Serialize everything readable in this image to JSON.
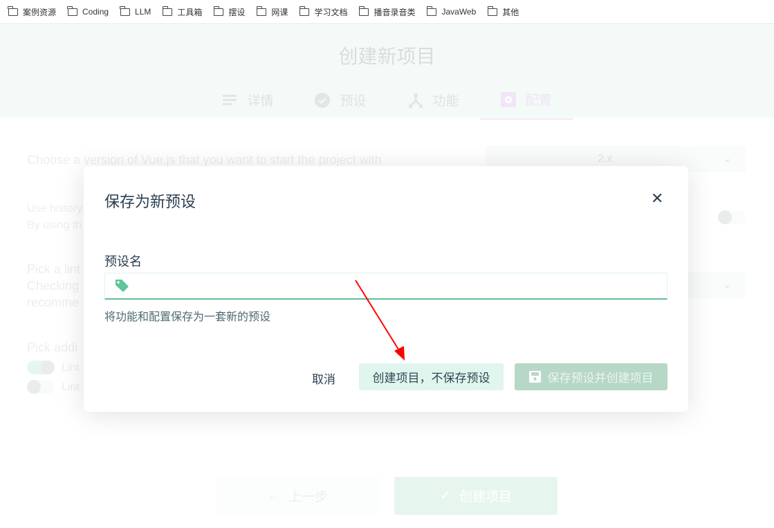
{
  "bookmarks": [
    "案例资源",
    "Coding",
    "LLM",
    "工具箱",
    "摆设",
    "网课",
    "学习文档",
    "播音录音类",
    "JavaWeb",
    "其他"
  ],
  "page": {
    "title": "创建新项目",
    "tabs": [
      {
        "label": "详情",
        "icon": "list-icon"
      },
      {
        "label": "预设",
        "icon": "check-circle-icon"
      },
      {
        "label": "功能",
        "icon": "fork-icon"
      },
      {
        "label": "配置",
        "icon": "gear-icon",
        "active": true
      }
    ],
    "vue_version_label": "Choose a version of Vue.js that you want to start the project with",
    "vue_version_value": "2.x",
    "history_label": "Use history",
    "history_desc": "By using th",
    "linter_label": "Pick a lint",
    "linter_desc1": "Checking",
    "linter_desc2": "recomme",
    "additional_label": "Pick addi",
    "lint_opt1": "Lint",
    "lint_opt2": "Lint",
    "back_button": "上一步",
    "create_button": "创建项目"
  },
  "modal": {
    "title": "保存为新预设",
    "field_label": "预设名",
    "field_value": "",
    "help_text": "将功能和配置保存为一套新的预设",
    "cancel": "取消",
    "create_without_save": "创建项目，不保存预设",
    "save_and_create": "保存预设并创建项目",
    "close_symbol": "✕"
  },
  "colors": {
    "accent": "#42b983",
    "arrow": "#ff0000"
  }
}
